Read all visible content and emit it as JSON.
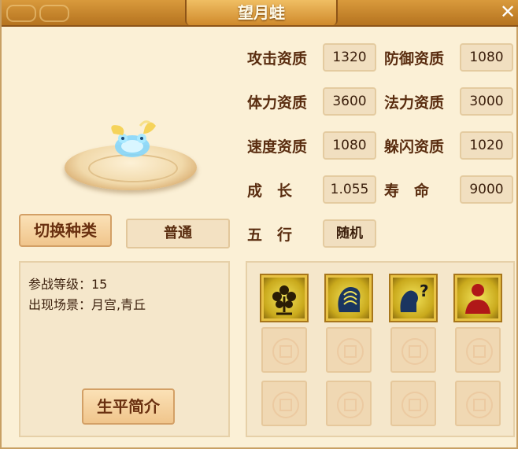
{
  "window": {
    "title": "望月蛙",
    "close": "✕"
  },
  "buttons": {
    "switch_type": "切换种类",
    "type_value": "普通",
    "bio": "生平简介"
  },
  "stats": [
    {
      "label": "攻击资质",
      "value": "1320"
    },
    {
      "label": "防御资质",
      "value": "1080"
    },
    {
      "label": "体力资质",
      "value": "3600"
    },
    {
      "label": "法力资质",
      "value": "3000"
    },
    {
      "label": "速度资质",
      "value": "1080"
    },
    {
      "label": "躲闪资质",
      "value": "1020"
    },
    {
      "label": "成　长",
      "value": "1.055"
    },
    {
      "label": "寿　命",
      "value": "9000"
    },
    {
      "label": "五　行",
      "value": "随机"
    }
  ],
  "info": {
    "level_line": "参战等级：15",
    "location_line": "出现场景：月宫,青丘"
  },
  "skills": [
    {
      "icon": "tree-icon"
    },
    {
      "icon": "mind-head-icon"
    },
    {
      "icon": "question-head-icon"
    },
    {
      "icon": "figure-icon"
    }
  ],
  "colors": {
    "title_bar": "#b5731f",
    "panel_bg": "#fbf0d6",
    "skill_border": "#e8c245"
  }
}
